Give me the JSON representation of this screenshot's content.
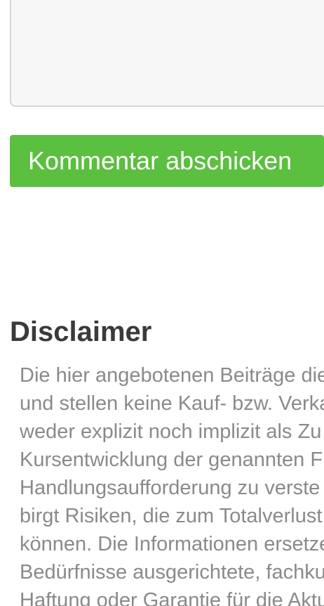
{
  "comment_form": {
    "submit_label": "Kommentar abschicken",
    "submit_color": "#5bbf3f"
  },
  "disclaimer": {
    "heading": "Disclaimer",
    "lines": [
      "Die hier angebotenen Beiträge die",
      "und stellen keine Kauf- bzw. Verka",
      "weder explizit noch implizit als Zu",
      "Kursentwicklung der genannten F",
      "Handlungsaufforderung zu verste",
      "birgt Risiken, die zum Totalverlust",
      "können. Die Informationen ersetze",
      "Bedürfnisse ausgerichtete, fachku",
      "Haftung oder Garantie für die Aktu"
    ]
  }
}
